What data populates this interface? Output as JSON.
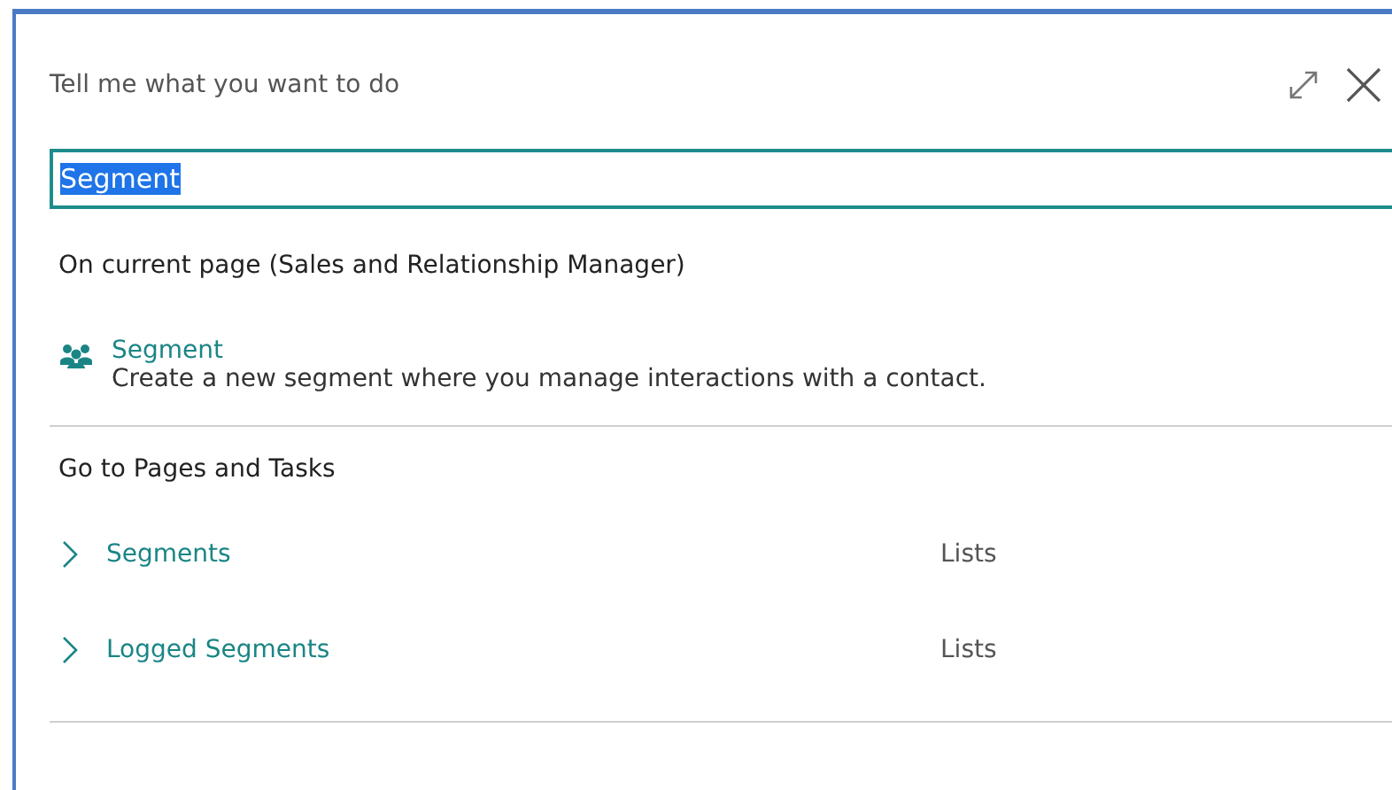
{
  "dialog": {
    "title": "Tell me what you want to do"
  },
  "search": {
    "value": "Segment",
    "selected_text": true
  },
  "sections": [
    {
      "heading": "On current page (Sales and Relationship Manager)",
      "items": [
        {
          "kind": "action",
          "title": "Segment",
          "description": "Create a new segment where you manage interactions with a contact."
        }
      ]
    },
    {
      "heading": "Go to Pages and Tasks",
      "items": [
        {
          "kind": "page",
          "title": "Segments",
          "category": "Lists"
        },
        {
          "kind": "page",
          "title": "Logged Segments",
          "category": "Lists"
        }
      ]
    }
  ]
}
